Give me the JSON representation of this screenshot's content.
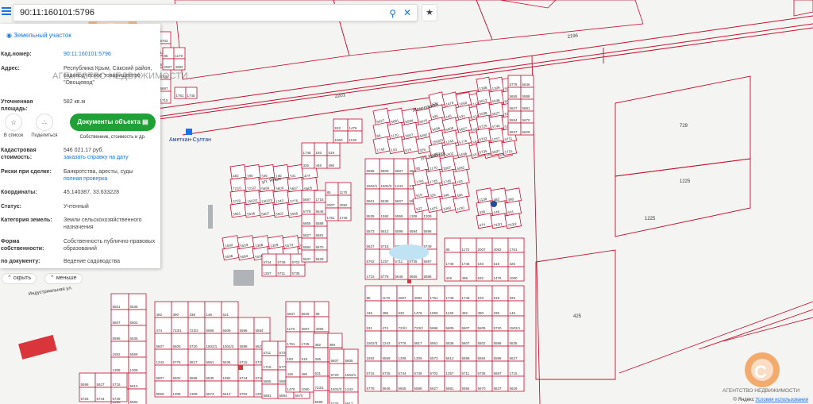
{
  "search": {
    "value": "90:11:160101:5796"
  },
  "panel": {
    "title": "Земельный участок",
    "rows": [
      {
        "key": "Кад.номер:",
        "value": "90:11:160101:5796"
      },
      {
        "key": "Адрес:",
        "value": "Республика Крым, Сакский район, садоводческое товарищество \"Овощевод\""
      },
      {
        "key": "Уточненная площадь:",
        "value": "582 кв.м"
      },
      {
        "key": "Кадастровая стоимость:",
        "value": "546 021.17 руб.",
        "link": "заказать справку на дату"
      },
      {
        "key": "Риски при сделке:",
        "value": "Банкротства, аресты, суды",
        "link": "полная проверка"
      },
      {
        "key": "Координаты:",
        "value": "45.140387, 33.633228"
      },
      {
        "key": "Статус:",
        "value": "Учтенный"
      },
      {
        "key": "Категория земель:",
        "value": "Земли сельскохозяйственного назначения"
      },
      {
        "key": "Форма собственности:",
        "value": "Собственность публично-правовых образований"
      },
      {
        "key": "по документу:",
        "value": "Ведение садоводства"
      }
    ],
    "actions": {
      "save": "В список",
      "share": "Поделиться",
      "docs": "Документы объекта",
      "docs_sub": "Собственник, стоимость и др."
    },
    "hide": "скрыть",
    "less": "меньше"
  },
  "watermark": {
    "text": "АГЕНТСТВО НЕДВИЖИМОСТИ"
  },
  "map": {
    "parcel_color": "#c8102e",
    "road_labels": [
      "2196",
      "2201",
      "Индустриальная ул.",
      "ул. Ялык",
      "Ул. Рыбная",
      "Жемчужная"
    ],
    "station": "Аметкан-Султан",
    "large_parcels": [
      "729",
      "1225",
      "1225",
      "425"
    ],
    "parcel_numbers": [
      "85",
      "1170",
      "2007",
      "4092",
      "1761",
      "1745",
      "1746",
      "193",
      "519",
      "326",
      "446",
      "496",
      "532",
      "1476",
      "1060",
      "1130",
      "482",
      "390",
      "336",
      "146",
      "531",
      "474",
      "723/1",
      "723/2",
      "5696",
      "5609",
      "5607",
      "5605",
      "5720",
      "1502/1",
      "1502/3",
      "1243",
      "5776",
      "5817",
      "5561",
      "5536",
      "5607",
      "5502",
      "5596",
      "5535",
      "1592",
      "5559",
      "1308",
      "1309",
      "5573",
      "5612",
      "5596",
      "5584",
      "5598",
      "5627",
      "5715",
      "5725",
      "5744",
      "5749",
      "5702",
      "1257",
      "5711",
      "5735",
      "5697",
      "1715",
      "5778",
      "5646",
      "5655",
      "5588",
      "5627",
      "5681",
      "5594",
      "5670",
      "5637",
      "5629"
    ]
  },
  "attribution": {
    "brand": "© Яндекс",
    "link": "Условия использования"
  }
}
